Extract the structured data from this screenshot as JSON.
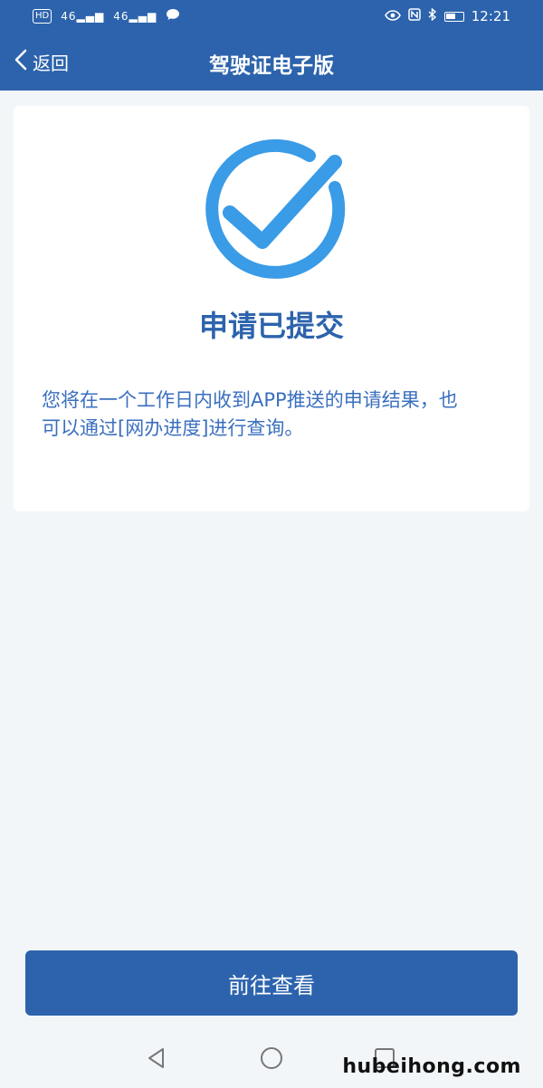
{
  "status_bar": {
    "left_badges": [
      "HD",
      "46",
      "46"
    ],
    "time": "12:21",
    "icons": [
      "eye-icon",
      "nfc-icon",
      "bluetooth-icon",
      "battery-icon"
    ]
  },
  "nav": {
    "back_label": "返回",
    "title": "驾驶证电子版"
  },
  "result": {
    "title": "申请已提交",
    "message": "您将在一个工作日内收到APP推送的申请结果，也可以通过[网办进度]进行查询。"
  },
  "actions": {
    "primary_label": "前往查看"
  },
  "watermark": "hubeihong.com",
  "colors": {
    "brand": "#2c63ac",
    "check": "#3a9be6",
    "background": "#f3f6f9"
  }
}
